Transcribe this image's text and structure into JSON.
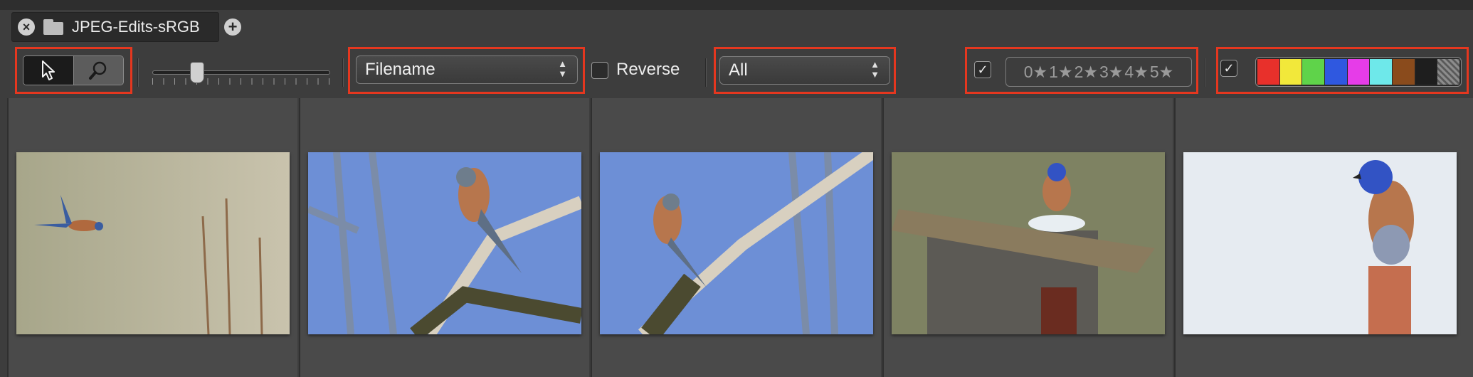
{
  "tab": {
    "title": "JPEG-Edits-sRGB"
  },
  "toolbar": {
    "tool_select": "select-arrow",
    "tool_zoom": "zoom",
    "sort": {
      "selected": "Filename"
    },
    "reverse": {
      "label": "Reverse",
      "checked": false
    },
    "filter": {
      "selected": "All"
    },
    "rating_filter": {
      "enabled": true,
      "labels": [
        "0★",
        "1★",
        "2★",
        "3★",
        "4★",
        "5★"
      ]
    },
    "color_filter": {
      "enabled": true,
      "colors": [
        "#e8302b",
        "#f2e83a",
        "#5fd34a",
        "#2f58e0",
        "#e63ce8",
        "#6ee8ea",
        "#8a4b1c",
        "#1e1e1e",
        "#8c8c8c"
      ]
    },
    "thumbnail_size": 0.23
  },
  "thumbnails": [
    {
      "subject": "bluebird-flying"
    },
    {
      "subject": "bluebird-on-branch-right"
    },
    {
      "subject": "bluebird-on-branch-left"
    },
    {
      "subject": "bluebird-on-birdhouse"
    },
    {
      "subject": "bluebird-on-post"
    }
  ]
}
